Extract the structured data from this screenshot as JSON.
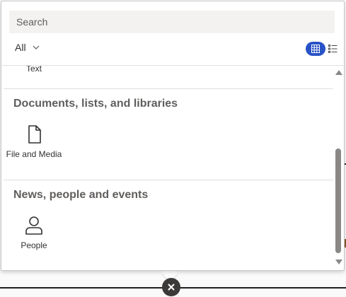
{
  "search": {
    "placeholder": "Search"
  },
  "filter": {
    "label": "All"
  },
  "partial_tile": {
    "label": "Text"
  },
  "sections": [
    {
      "title": "Documents, lists, and libraries",
      "tiles": [
        {
          "label": "File and Media",
          "icon": "document-icon"
        }
      ]
    },
    {
      "title": "News, people and events",
      "tiles": [
        {
          "label": "People",
          "icon": "person-icon"
        }
      ]
    }
  ],
  "colors": {
    "accent": "#2852c6",
    "close_button": "#3b3a39",
    "section_title": "#605e5c"
  }
}
